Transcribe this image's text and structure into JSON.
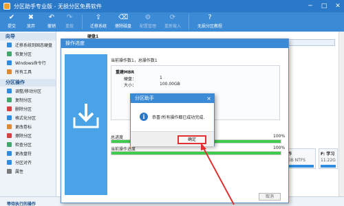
{
  "window": {
    "title": "分区助手专业版 - 无损分区免费软件",
    "controls": [
      "─",
      "□",
      "✕"
    ]
  },
  "toolbar": {
    "items": [
      {
        "label": "提交",
        "icon": "check-icon",
        "glyph": "✔",
        "enabled": true
      },
      {
        "label": "放弃",
        "icon": "cancel-icon",
        "glyph": "✖",
        "enabled": true
      },
      {
        "label": "撤销",
        "icon": "undo-icon",
        "glyph": "↶",
        "enabled": true
      },
      {
        "label": "重做",
        "icon": "redo-icon",
        "glyph": "↷",
        "enabled": false
      },
      {
        "label": "迁移系统",
        "icon": "migrate-icon",
        "glyph": "⇪",
        "enabled": true
      },
      {
        "label": "擦除磁盘",
        "icon": "erase-icon",
        "glyph": "⌫",
        "enabled": true
      },
      {
        "label": "配置管理",
        "icon": "settings-icon",
        "glyph": "⚙",
        "enabled": false
      },
      {
        "label": "重新载入",
        "icon": "reload-icon",
        "glyph": "⟳",
        "enabled": false
      },
      {
        "label": "无损分区教程",
        "icon": "tutorial-icon",
        "glyph": "?",
        "enabled": true
      }
    ]
  },
  "sidebar": {
    "wizard_header": "向导",
    "wizard_items": [
      {
        "label": "迁移系统到固态硬盘",
        "color": "#2f8ce0"
      },
      {
        "label": "恢复分区",
        "color": "#3fa86a"
      },
      {
        "label": "Windows命令行",
        "color": "#2f8ce0"
      },
      {
        "label": "所有工具",
        "color": "#e08a2f"
      }
    ],
    "partition_header": "分区操作",
    "partition_items": [
      {
        "label": "调整/移动分区",
        "color": "#2f8ce0"
      },
      {
        "label": "复制分区",
        "color": "#3fa86a"
      },
      {
        "label": "删除分区",
        "color": "#d84040"
      },
      {
        "label": "格式化分区",
        "color": "#2f8ce0"
      },
      {
        "label": "更改卷标",
        "color": "#e08a2f"
      },
      {
        "label": "擦除分区",
        "color": "#d84040"
      },
      {
        "label": "检查分区",
        "color": "#3fa86a"
      },
      {
        "label": "更改盘符",
        "color": "#2f8ce0"
      },
      {
        "label": "分区对齐",
        "color": "#2f8ce0"
      },
      {
        "label": "属性",
        "color": "#7a7a7a"
      }
    ],
    "bottom_header": "等待执行的操作"
  },
  "main": {
    "disk_label": "硬盘1",
    "tiles": [
      {
        "name": "作",
        "size": "GB NTFS"
      },
      {
        "name": "F: 学习",
        "size": "11.22G"
      }
    ]
  },
  "progress_dialog": {
    "title": "操作进度",
    "current_op": "当前操作数1，总操作数1",
    "op_name": "重建MBR",
    "disk_key": "硬盘：",
    "disk_val": "1",
    "size_key": "大小：",
    "size_val": "100.00GB",
    "total_label": "总进度",
    "total_pct": "100%",
    "total_progress": 1.0,
    "current_label": "当前操作进度",
    "current_pct": "100%",
    "current_progress": 1.0,
    "cancel_label": "取消"
  },
  "alert": {
    "title": "分区助手",
    "close_glyph": "×",
    "icon_glyph": "i",
    "message": "恭喜!所有操作都已成功完成.",
    "ok_label": "确定"
  },
  "colors": {
    "accent": "#3b8ad6",
    "highlight": "#e03030",
    "progress": "#3fcc4e"
  }
}
